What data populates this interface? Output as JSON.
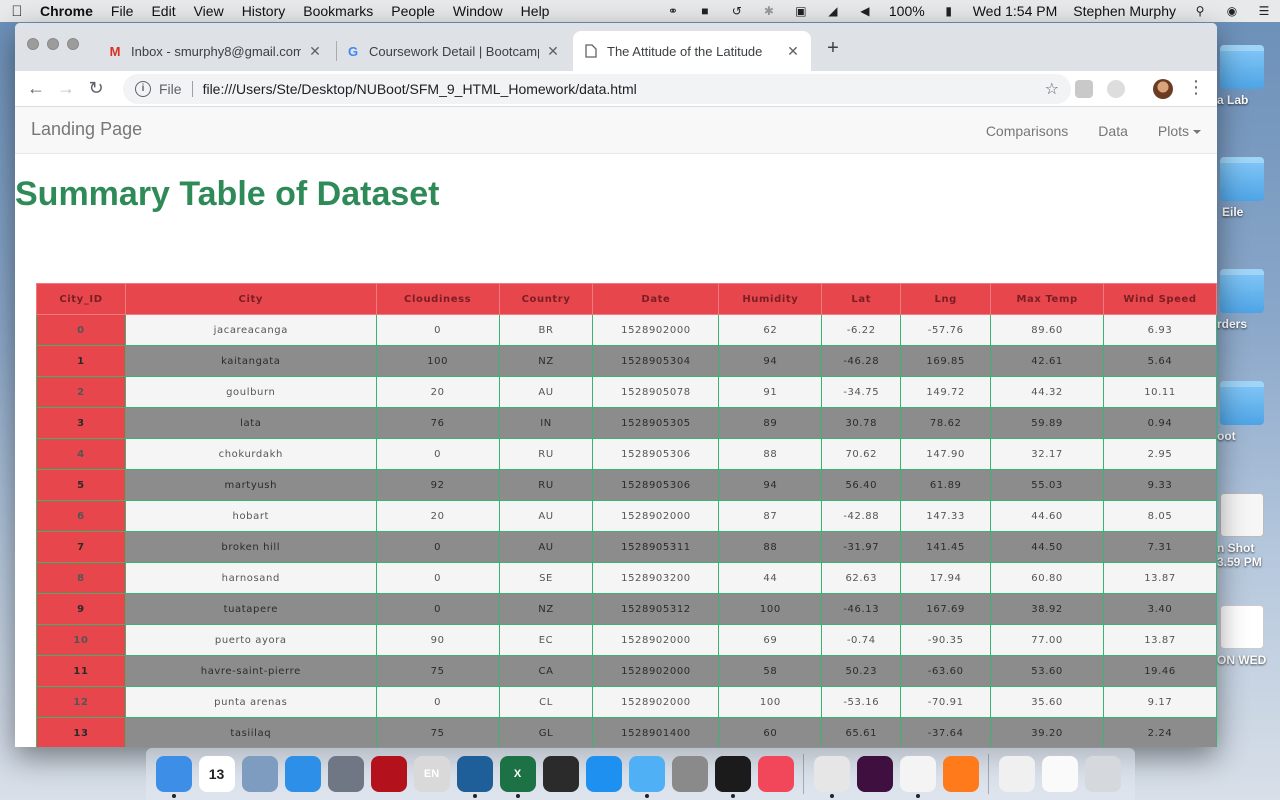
{
  "menubar": {
    "app": "Chrome",
    "items": [
      "File",
      "Edit",
      "View",
      "History",
      "Bookmarks",
      "People",
      "Window",
      "Help"
    ],
    "battery": "100%",
    "clock": "Wed 1:54 PM",
    "user": "Stephen Murphy"
  },
  "desktop": {
    "items": [
      {
        "label": "a Lab",
        "icon": "folder-icon"
      },
      {
        "label": "Eile",
        "icon": "folder-icon"
      },
      {
        "label": "rders",
        "icon": "folder-icon"
      },
      {
        "label": "oot",
        "icon": "folder-icon"
      },
      {
        "label": "n Shot",
        "label2": "3.59 PM",
        "icon": "screenshot-file-icon"
      },
      {
        "label": "ON WED",
        "icon": "document-icon"
      }
    ]
  },
  "browser": {
    "tabs": [
      {
        "title": "Inbox - smurphy8@gmail.com",
        "favicon": "gmail-icon",
        "active": false
      },
      {
        "title": "Coursework Detail | Bootcamp",
        "favicon": "google-icon",
        "active": false
      },
      {
        "title": "The Attitude of the Latitude",
        "favicon": "page-icon",
        "active": true
      }
    ],
    "address": {
      "scheme": "File",
      "url": "file:///Users/Ste/Desktop/NUBoot/SFM_9_HTML_Homework/data.html"
    }
  },
  "page": {
    "brand": "Landing Page",
    "nav": {
      "comparisons": "Comparisons",
      "data": "Data",
      "plots": "Plots"
    },
    "title": "Summary Table of Dataset"
  },
  "table": {
    "columns": [
      "City_ID",
      "City",
      "Cloudiness",
      "Country",
      "Date",
      "Humidity",
      "Lat",
      "Lng",
      "Max Temp",
      "Wind Speed"
    ],
    "rows": [
      [
        "0",
        "jacareacanga",
        "0",
        "BR",
        "1528902000",
        "62",
        "-6.22",
        "-57.76",
        "89.60",
        "6.93"
      ],
      [
        "1",
        "kaitangata",
        "100",
        "NZ",
        "1528905304",
        "94",
        "-46.28",
        "169.85",
        "42.61",
        "5.64"
      ],
      [
        "2",
        "goulburn",
        "20",
        "AU",
        "1528905078",
        "91",
        "-34.75",
        "149.72",
        "44.32",
        "10.11"
      ],
      [
        "3",
        "lata",
        "76",
        "IN",
        "1528905305",
        "89",
        "30.78",
        "78.62",
        "59.89",
        "0.94"
      ],
      [
        "4",
        "chokurdakh",
        "0",
        "RU",
        "1528905306",
        "88",
        "70.62",
        "147.90",
        "32.17",
        "2.95"
      ],
      [
        "5",
        "martyush",
        "92",
        "RU",
        "1528905306",
        "94",
        "56.40",
        "61.89",
        "55.03",
        "9.33"
      ],
      [
        "6",
        "hobart",
        "20",
        "AU",
        "1528902000",
        "87",
        "-42.88",
        "147.33",
        "44.60",
        "8.05"
      ],
      [
        "7",
        "broken hill",
        "0",
        "AU",
        "1528905311",
        "88",
        "-31.97",
        "141.45",
        "44.50",
        "7.31"
      ],
      [
        "8",
        "harnosand",
        "0",
        "SE",
        "1528903200",
        "44",
        "62.63",
        "17.94",
        "60.80",
        "13.87"
      ],
      [
        "9",
        "tuatapere",
        "0",
        "NZ",
        "1528905312",
        "100",
        "-46.13",
        "167.69",
        "38.92",
        "3.40"
      ],
      [
        "10",
        "puerto ayora",
        "90",
        "EC",
        "1528902000",
        "69",
        "-0.74",
        "-90.35",
        "77.00",
        "13.87"
      ],
      [
        "11",
        "havre-saint-pierre",
        "75",
        "CA",
        "1528902000",
        "58",
        "50.23",
        "-63.60",
        "53.60",
        "19.46"
      ],
      [
        "12",
        "punta arenas",
        "0",
        "CL",
        "1528902000",
        "100",
        "-53.16",
        "-70.91",
        "35.60",
        "9.17"
      ],
      [
        "13",
        "tasiilaq",
        "75",
        "GL",
        "1528901400",
        "60",
        "65.61",
        "-37.64",
        "39.20",
        "2.24"
      ]
    ]
  },
  "dock": {
    "items": [
      {
        "name": "finder-icon",
        "color": "#3d8ee6",
        "running": true
      },
      {
        "name": "calendar-icon",
        "color": "#ffffff",
        "label": "13",
        "running": false
      },
      {
        "name": "preview-icon",
        "color": "#7d9cc0",
        "running": false
      },
      {
        "name": "safari-icon",
        "color": "#2d8fe8",
        "running": false
      },
      {
        "name": "launchpad-icon",
        "color": "#6f7785",
        "running": false
      },
      {
        "name": "acrobat-icon",
        "color": "#b3121c",
        "running": false
      },
      {
        "name": "evernote-icon",
        "color": "#d9d9d9",
        "label": "EN",
        "running": false
      },
      {
        "name": "vscode-icon",
        "color": "#1f5f99",
        "running": true
      },
      {
        "name": "excel-icon",
        "color": "#1d7245",
        "label": "X",
        "running": true
      },
      {
        "name": "photo-app-icon",
        "color": "#2b2b2b",
        "running": false
      },
      {
        "name": "app-store-icon",
        "color": "#1e90f0",
        "running": false
      },
      {
        "name": "messages-icon",
        "color": "#4fb0f5",
        "running": true
      },
      {
        "name": "system-preferences-icon",
        "color": "#8a8a8a",
        "running": false
      },
      {
        "name": "terminal-icon",
        "color": "#1b1b1b",
        "running": true
      },
      {
        "name": "news-icon",
        "color": "#f2475a",
        "running": false
      },
      {
        "name": "chrome-icon",
        "color": "#e6e6e6",
        "running": true
      },
      {
        "name": "slack-icon",
        "color": "#3f0f40",
        "running": false
      },
      {
        "name": "notes-icon",
        "color": "#f4f4f4",
        "running": true
      },
      {
        "name": "firefox-icon",
        "color": "#ff7a1a",
        "running": false
      },
      {
        "name": "vlc-icon",
        "color": "#f0f0f0",
        "running": false
      },
      {
        "name": "window-preview-icon",
        "color": "#fafafa",
        "running": false
      },
      {
        "name": "trash-icon",
        "color": "#d5d8dc",
        "running": false
      }
    ]
  }
}
